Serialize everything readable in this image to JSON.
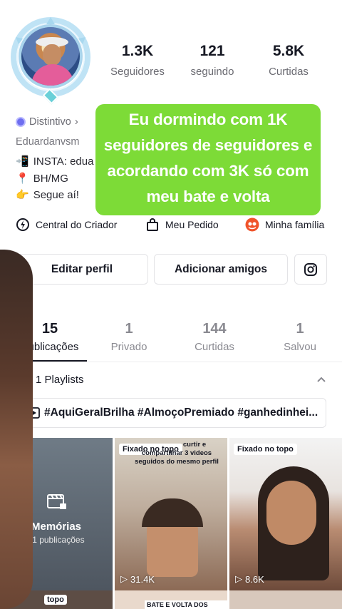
{
  "profile": {
    "stats": [
      {
        "value": "1.3K",
        "label": "Seguidores"
      },
      {
        "value": "121",
        "label": "seguindo"
      },
      {
        "value": "5.8K",
        "label": "Curtidas"
      }
    ],
    "badge_label": "Distintivo",
    "username": "Eduardanvsm",
    "bio": [
      {
        "emoji": "📲",
        "text": "INSTA: edua"
      },
      {
        "emoji": "📍",
        "text": "BH/MG"
      },
      {
        "emoji": "👉",
        "text": "Segue aí!"
      }
    ]
  },
  "overlay_caption": "Eu dormindo com 1K seguidores de seguidores e acordando com 3K só com meu bate e volta",
  "quick_actions": [
    {
      "icon": "creator-center-icon",
      "label": "Central do Criador"
    },
    {
      "icon": "bag-icon",
      "label": "Meu Pedido"
    },
    {
      "icon": "family-icon",
      "label": "Minha família"
    }
  ],
  "buttons": {
    "edit": "Editar perfil",
    "add_friends": "Adicionar amigos",
    "instagram_icon": "instagram-icon"
  },
  "tabs": [
    {
      "count": "15",
      "label": "Publicações"
    },
    {
      "count": "1",
      "label": "Privado"
    },
    {
      "count": "144",
      "label": "Curtidas"
    },
    {
      "count": "1",
      "label": "Salvou"
    }
  ],
  "playlists": {
    "header": "1 Playlists",
    "tags": "#AquiGeralBrilha #AlmoçoPremiado #ganhedinhei..."
  },
  "grid": [
    {
      "type": "memories",
      "title": "Memórias",
      "subtitle": "11 publicações"
    },
    {
      "pinned": "Fixado no topo",
      "caption_lines": [
        "curtir e",
        "compartilhar 3 videos",
        "seguidos do mesmo perfil"
      ],
      "views": "31.4K"
    },
    {
      "pinned": "Fixado no topo",
      "views": "8.6K"
    }
  ],
  "bottom_strip": {
    "left_label": "topo",
    "middle_label": "BATE E VOLTA DOS MEUS"
  },
  "colors": {
    "accent_green": "#7ddb37",
    "text_primary": "#161823",
    "text_secondary": "#6b6b72"
  }
}
